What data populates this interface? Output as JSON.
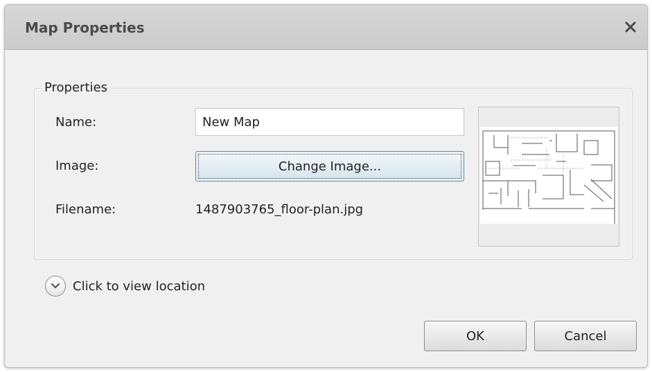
{
  "dialog": {
    "title": "Map Properties"
  },
  "properties": {
    "legend": "Properties",
    "name_label": "Name:",
    "name_value": "New Map",
    "image_label": "Image:",
    "change_image_label": "Change Image...",
    "filename_label": "Filename:",
    "filename_value": "1487903765_floor-plan.jpg"
  },
  "location_toggle": {
    "label": "Click to view location",
    "expanded": false
  },
  "footer": {
    "ok_label": "OK",
    "cancel_label": "Cancel"
  },
  "icons": {
    "close": "close-icon",
    "expand": "chevron-down-icon",
    "thumbnail": "floor-plan-thumbnail"
  },
  "colors": {
    "titlebar": "#d0d0d0",
    "dialog_bg": "#f0f0f0",
    "focus_border": "#5b8aa8"
  }
}
